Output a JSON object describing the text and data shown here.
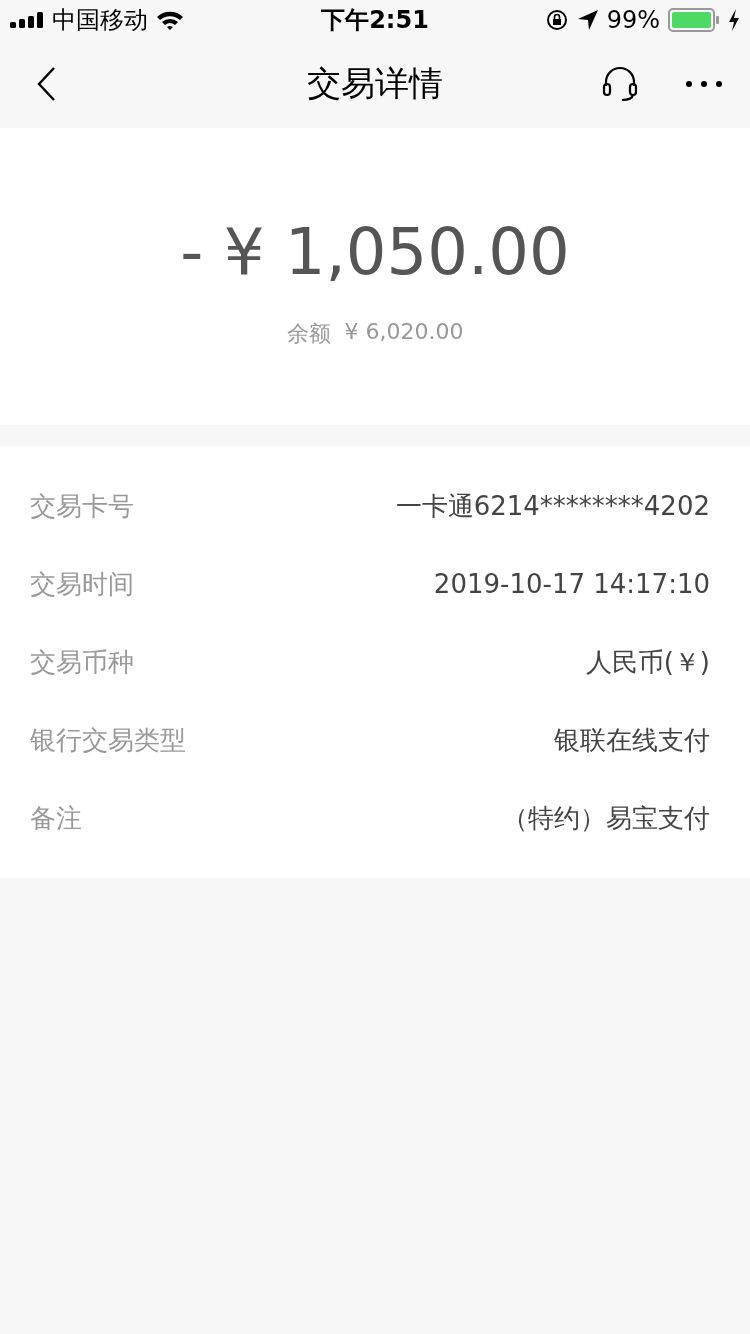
{
  "status_bar": {
    "carrier": "中国移动",
    "time": "下午2:51",
    "battery_percent": "99%"
  },
  "nav": {
    "title": "交易详情"
  },
  "summary": {
    "amount": "- ¥ 1,050.00",
    "balance_label": "余额",
    "balance": "¥ 6,020.00"
  },
  "details": [
    {
      "label": "交易卡号",
      "value": "一卡通6214********4202"
    },
    {
      "label": "交易时间",
      "value": "2019-10-17 14:17:10"
    },
    {
      "label": "交易币种",
      "value": "人民币(￥)"
    },
    {
      "label": "银行交易类型",
      "value": "银联在线支付"
    },
    {
      "label": "备注",
      "value": "（特约）易宝支付"
    }
  ]
}
